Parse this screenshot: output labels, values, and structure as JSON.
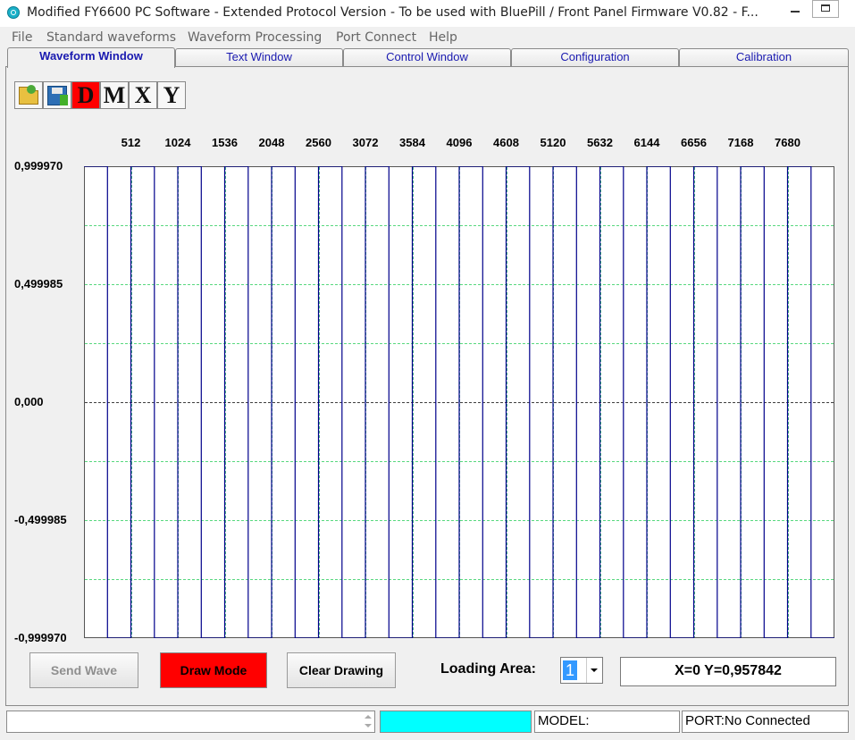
{
  "window": {
    "title": "Modified FY6600 PC Software - Extended Protocol Version - To be used with BluePill / Front Panel Firmware V0.82 - F..."
  },
  "menu": [
    "File",
    "Standard waveforms",
    "Waveform Processing",
    "Port Connect",
    "Help"
  ],
  "tabs": [
    "Waveform Window",
    "Text Window",
    "Control Window",
    "Configuration",
    "Calibration"
  ],
  "toolbar": {
    "open_icon": "folder-open-icon",
    "save_icon": "save-disk-icon",
    "d_label": "D",
    "m_label": "M",
    "x_label": "X",
    "y_label": "Y",
    "d_color": "#ff0000"
  },
  "chart_data": {
    "type": "line",
    "x_ticks": [
      "512",
      "1024",
      "1536",
      "2048",
      "2560",
      "3072",
      "3584",
      "4096",
      "4608",
      "5120",
      "5632",
      "6144",
      "6656",
      "7168",
      "7680"
    ],
    "y_ticks": [
      "0,999970",
      "0,499985",
      "0,000",
      "-0,499985",
      "-0,999970"
    ],
    "xlim": [
      0,
      8192
    ],
    "ylim": [
      -0.99997,
      0.99997
    ],
    "grid": true,
    "series": [
      {
        "waveform": "square",
        "period": 512,
        "high": 0.99997,
        "low": -0.99997,
        "color": "#00008b"
      }
    ]
  },
  "controls": {
    "send_wave": "Send Wave",
    "draw_mode": "Draw Mode",
    "clear_drawing": "Clear Drawing",
    "loading_area_label": "Loading Area:",
    "loading_area_value": "1",
    "coordinates": "X=0 Y=0,957842"
  },
  "statusbar": {
    "model": "MODEL:",
    "port": "PORT:No Connected",
    "indicator_color": "#00ffff"
  }
}
